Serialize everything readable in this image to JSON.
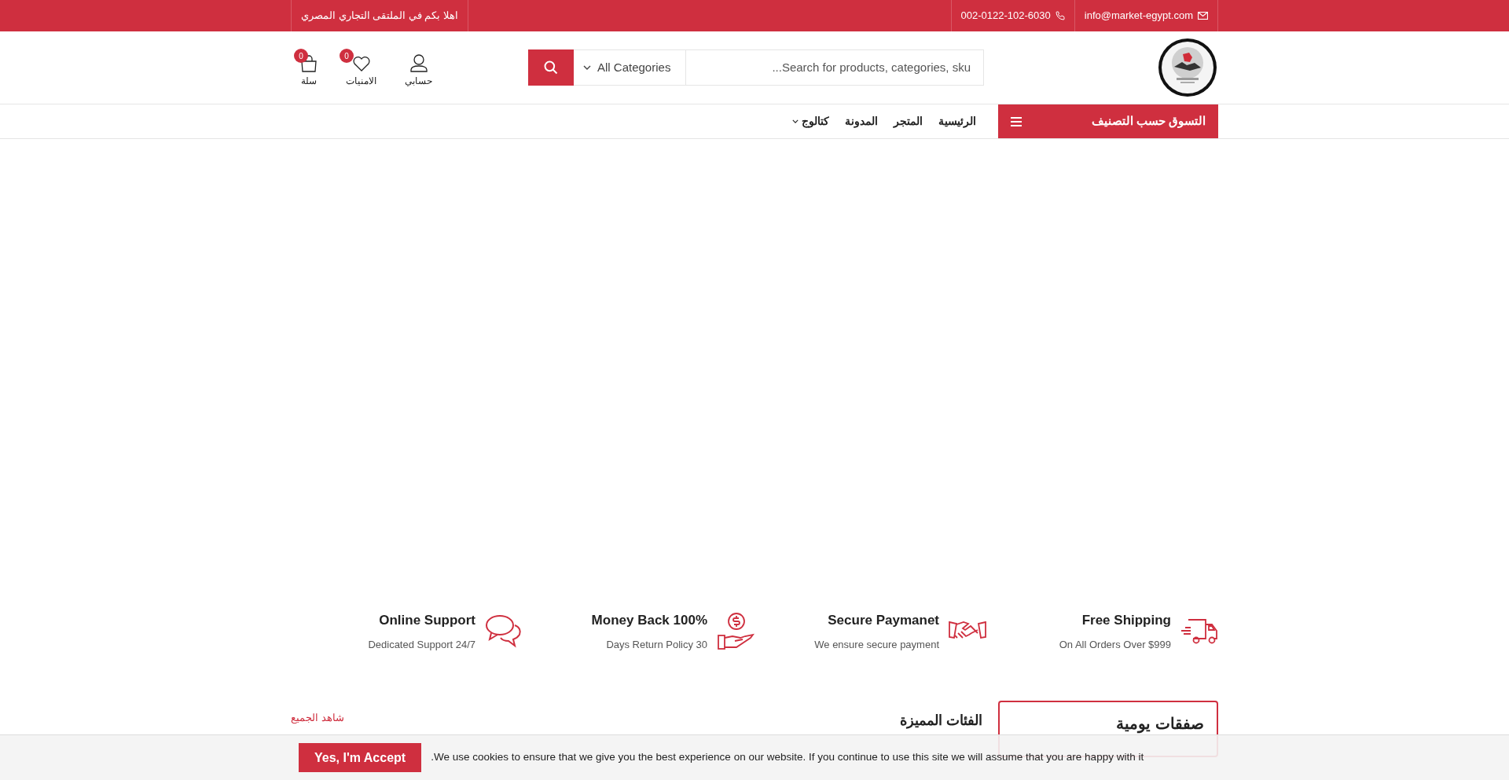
{
  "top_bar": {
    "email": "info@market-egypt.com",
    "phone": "002-0122-102-6030",
    "welcome": "اهلا بكم في الملتقى التجاري المصري"
  },
  "header": {
    "search": {
      "placeholder": "...Search for products, categories, sku",
      "category": "All Categories"
    },
    "actions": [
      {
        "kind": "account",
        "label": "حسابي"
      },
      {
        "kind": "wishlist",
        "label": "الامنيات",
        "count": "0"
      },
      {
        "kind": "cart",
        "label": "سلة",
        "count": "0"
      }
    ]
  },
  "nav": {
    "categories_button": "التسوق حسب التصنيف",
    "links": [
      {
        "label": "الرئيسية",
        "dropdown": false
      },
      {
        "label": "المتجر",
        "dropdown": false
      },
      {
        "label": "المدونة",
        "dropdown": false
      },
      {
        "label": "كتالوج",
        "dropdown": true
      }
    ]
  },
  "features": [
    {
      "kind": "truck",
      "title": "Free Shipping",
      "subtitle": "On All Orders Over $999"
    },
    {
      "kind": "handshake",
      "title": "Secure Paymanet",
      "subtitle": "We ensure secure payment"
    },
    {
      "kind": "money",
      "title": "Money Back 100%",
      "subtitle": "Days Return Policy 30"
    },
    {
      "kind": "chat",
      "title": "Online Support",
      "subtitle": "Dedicated Support 24/7"
    }
  ],
  "sections": {
    "deals_title": "صفقات يومية",
    "categories_title": "الفئات المميزة",
    "view_all": "شاهد الجميع"
  },
  "cookie_bar": {
    "message": ".We use cookies to ensure that we give you the best experience on our website. If you continue to use this site we will assume that you are happy with it",
    "accept": "Yes, I'm Accept"
  }
}
